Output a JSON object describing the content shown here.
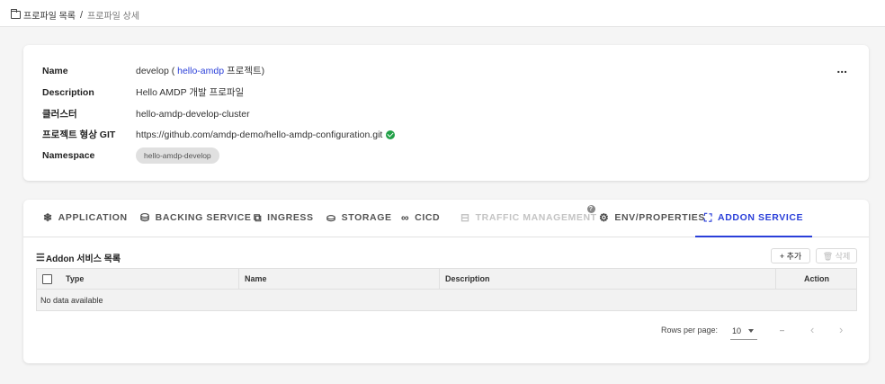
{
  "breadcrumb": {
    "icon": "folder-icon",
    "root": "프로파일 목록",
    "separator": "/",
    "current": "프로파일 상세"
  },
  "profile": {
    "more_label": "...",
    "name_label": "Name",
    "name_prefix": "develop (",
    "name_link": "hello-amdp",
    "name_suffix": "프로젝트)",
    "description_label": "Description",
    "description": "Hello AMDP 개발 프로파일",
    "cluster_label": "클러스터",
    "cluster": "hello-amdp-develop-cluster",
    "git_label": "프로젝트 형상 GIT",
    "git_url": "https://github.com/amdp-demo/hello-amdp-configuration.git",
    "namespace_label": "Namespace",
    "namespace": "hello-amdp-develop"
  },
  "tabs": [
    {
      "label": "APPLICATION",
      "icon": "cog-icon",
      "glyph": "❄"
    },
    {
      "label": "BACKING SERVICE",
      "icon": "database-icon",
      "glyph": "⛁"
    },
    {
      "label": "INGRESS",
      "icon": "open-in-new-icon",
      "glyph": "⧉"
    },
    {
      "label": "STORAGE",
      "icon": "storage-icon",
      "glyph": "⛀"
    },
    {
      "label": "CICD",
      "icon": "infinity-icon",
      "glyph": "∞"
    },
    {
      "label": "TRAFFIC MANAGEMENT",
      "icon": "traffic-icon",
      "glyph": "⊟",
      "help": "?"
    },
    {
      "label": "ENV/PROPERTIES",
      "icon": "settings-icon",
      "glyph": "⚙"
    },
    {
      "label": "ADDON SERVICE",
      "icon": "addon-icon",
      "glyph": "⛶"
    }
  ],
  "addon": {
    "title": "Addon 서비스 목록",
    "title_icon": "list-icon",
    "add_label": "+ 추가",
    "delete_label": "🗑 삭제",
    "columns": [
      "Type",
      "Name",
      "Description",
      "Action"
    ],
    "empty_text": "No data available"
  },
  "pagination": {
    "rows_per_page_label": "Rows per page:",
    "rows_per_page": "10",
    "range": "–",
    "prev": "‹",
    "next": "›"
  },
  "colors": {
    "accent": "#2a3fd9",
    "success": "#21a047"
  }
}
